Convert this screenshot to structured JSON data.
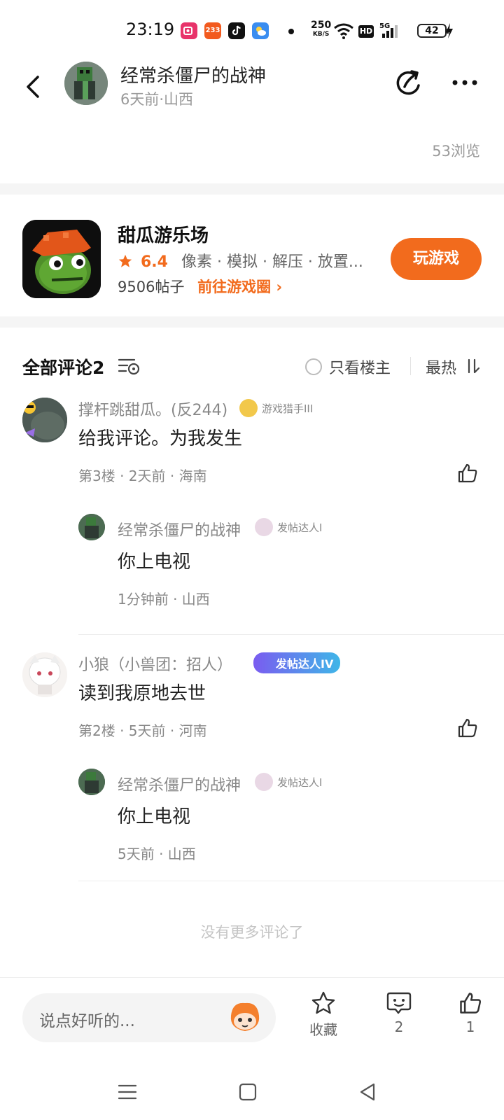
{
  "status_bar": {
    "time": "23:19",
    "net_speed": "250",
    "net_unit": "KB/S",
    "battery": "42",
    "apps": [
      "screen-recorder-icon",
      "233-app-icon",
      "tiktok-icon",
      "weather-icon"
    ]
  },
  "header": {
    "author_name": "经常杀僵尸的战神",
    "author_meta": "6天前·山西"
  },
  "post": {
    "views": "53浏览"
  },
  "game_card": {
    "title": "甜瓜游乐场",
    "rating": "6.4",
    "tags": "像素 · 模拟 · 解压 · 放置...",
    "posts": "9506帖子",
    "goto_label": "前往游戏圈 ›",
    "play_label": "玩游戏"
  },
  "comments_header": {
    "title": "全部评论2",
    "only_author": "只看楼主",
    "sort_label": "最热"
  },
  "comments": [
    {
      "name": "撑杆跳甜瓜。(反244)",
      "badge": "游戏猎手III",
      "text": "给我评论。为我发生",
      "meta": "第3楼 · 2天前 · 海南",
      "reply": {
        "name": "经常杀僵尸的战神",
        "badge": "发帖达人I",
        "text": "你上电视",
        "meta": "1分钟前 · 山西"
      }
    },
    {
      "name": "小狼（小兽团：招人）",
      "badge": "发帖达人IV",
      "text": "读到我原地去世",
      "meta": "第2楼 · 5天前 · 河南",
      "reply": {
        "name": "经常杀僵尸的战神",
        "badge": "发帖达人I",
        "text": "你上电视",
        "meta": "5天前 · 山西"
      }
    }
  ],
  "no_more": "没有更多评论了",
  "bottom_bar": {
    "input_placeholder": "说点好听的...",
    "favorite_label": "收藏",
    "comment_count": "2",
    "like_count": "1"
  },
  "colors": {
    "accent": "#f26b1d",
    "muted_text": "#999999",
    "divider": "#f5f5f5"
  }
}
